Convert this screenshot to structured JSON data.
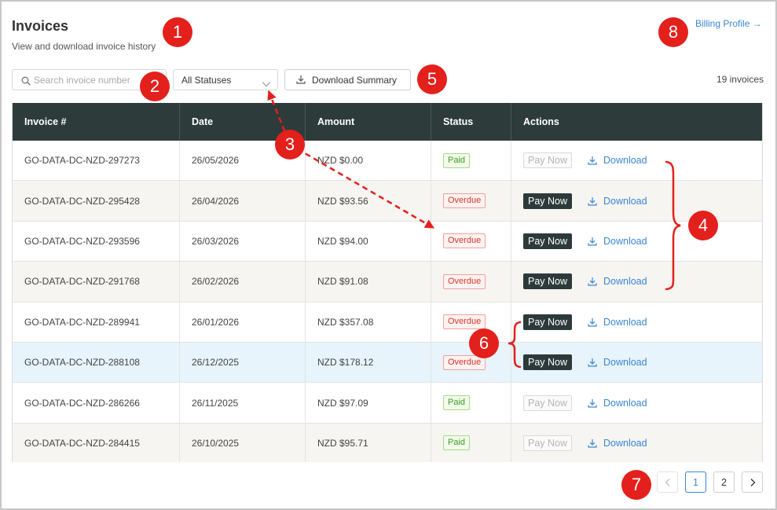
{
  "header": {
    "title": "Invoices",
    "subtitle": "View and download invoice history",
    "billing_link": "Billing Profile →"
  },
  "toolbar": {
    "search_placeholder": "Search invoice number",
    "status_filter": "All Statuses",
    "download_summary_label": "Download Summary",
    "count_label": "19 invoices"
  },
  "table": {
    "columns": [
      "Invoice #",
      "Date",
      "Amount",
      "Status",
      "Actions"
    ],
    "action_labels": {
      "pay": "Pay Now",
      "download": "Download"
    },
    "rows": [
      {
        "invoice": "GO-DATA-DC-NZD-297273",
        "date": "26/05/2026",
        "amount": "NZD $0.00",
        "status": "Paid",
        "pay_enabled": false,
        "highlighted": false
      },
      {
        "invoice": "GO-DATA-DC-NZD-295428",
        "date": "26/04/2026",
        "amount": "NZD $93.56",
        "status": "Overdue",
        "pay_enabled": true,
        "highlighted": false
      },
      {
        "invoice": "GO-DATA-DC-NZD-293596",
        "date": "26/03/2026",
        "amount": "NZD $94.00",
        "status": "Overdue",
        "pay_enabled": true,
        "highlighted": false
      },
      {
        "invoice": "GO-DATA-DC-NZD-291768",
        "date": "26/02/2026",
        "amount": "NZD $91.08",
        "status": "Overdue",
        "pay_enabled": true,
        "highlighted": false
      },
      {
        "invoice": "GO-DATA-DC-NZD-289941",
        "date": "26/01/2026",
        "amount": "NZD $357.08",
        "status": "Overdue",
        "pay_enabled": true,
        "highlighted": false
      },
      {
        "invoice": "GO-DATA-DC-NZD-288108",
        "date": "26/12/2025",
        "amount": "NZD $178.12",
        "status": "Overdue",
        "pay_enabled": true,
        "highlighted": true
      },
      {
        "invoice": "GO-DATA-DC-NZD-286266",
        "date": "26/11/2025",
        "amount": "NZD $97.09",
        "status": "Paid",
        "pay_enabled": false,
        "highlighted": false
      },
      {
        "invoice": "GO-DATA-DC-NZD-284415",
        "date": "26/10/2025",
        "amount": "NZD $95.71",
        "status": "Paid",
        "pay_enabled": false,
        "highlighted": false
      }
    ]
  },
  "pagination": {
    "prev_enabled": false,
    "next_enabled": true,
    "pages": [
      {
        "label": "1",
        "active": true
      },
      {
        "label": "2",
        "active": false
      }
    ]
  },
  "annotations": {
    "markers": [
      "1",
      "2",
      "3",
      "4",
      "5",
      "6",
      "7",
      "8"
    ]
  },
  "icons": {
    "search": "search-icon",
    "status_filter": "chevron-down-icon",
    "download": "download-icon",
    "prev_page": "chevron-left-icon",
    "next_page": "chevron-right-icon"
  },
  "colors": {
    "header_background": "#2e3b3b",
    "primary_button": "#2d3a3a",
    "link": "#3a86d2",
    "paid": "#3d9a2a",
    "overdue": "#d9342b",
    "row_highlight": "#e7f4fc",
    "annotation": "#e3201b"
  }
}
